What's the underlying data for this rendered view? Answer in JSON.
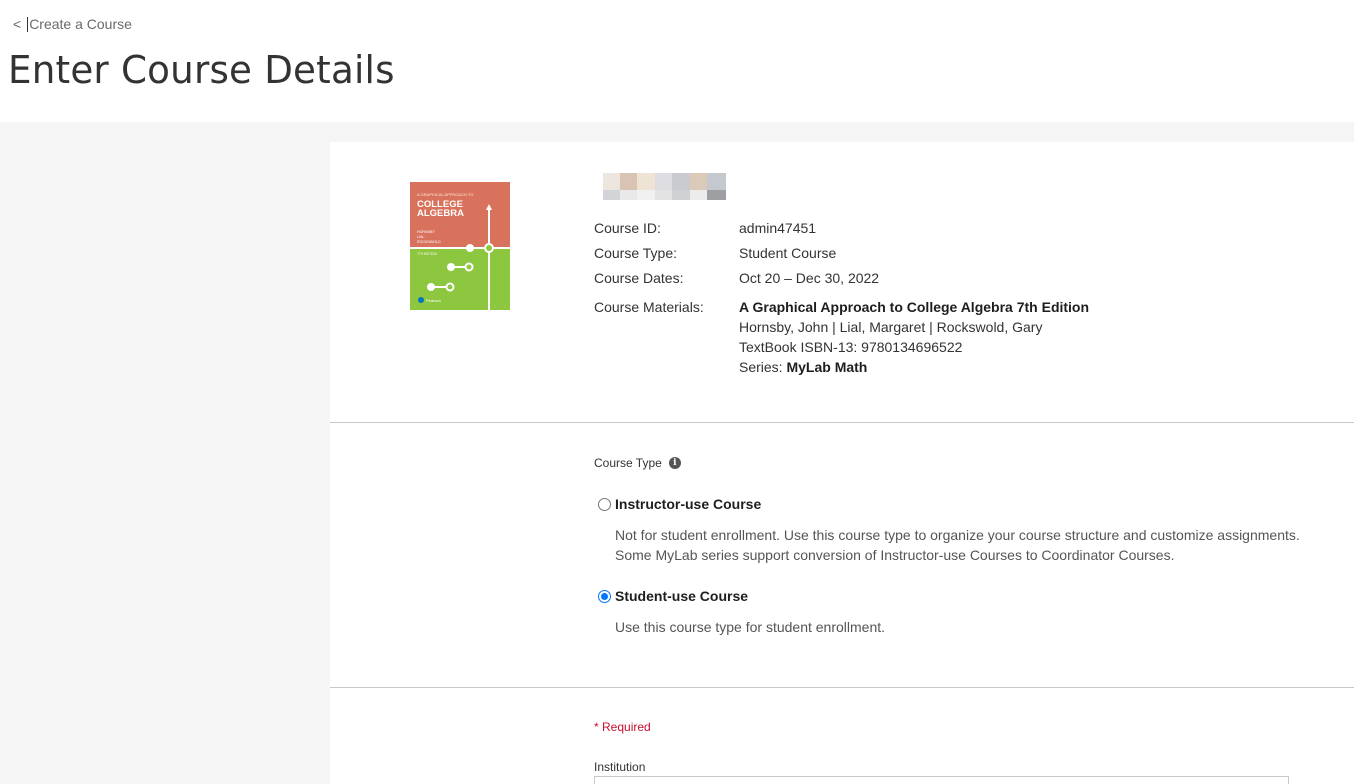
{
  "header": {
    "back_chevron": "<",
    "back_label": "Create a Course",
    "title": "Enter Course Details"
  },
  "course": {
    "cover": {
      "top_line": "A GRAPHICAL APPROACH TO",
      "title_line1": "COLLEGE",
      "title_line2": "ALGEBRA",
      "authors": [
        "HORNSBY",
        "LIAL",
        "ROCKSWOLD"
      ],
      "edition": "7TH EDITION",
      "publisher": "Pearson",
      "colors": {
        "top": "#d9725d",
        "bottom": "#8dc63f"
      }
    },
    "details": {
      "course_id_label": "Course ID:",
      "course_id": "admin47451",
      "course_type_label": "Course Type:",
      "course_type": "Student Course",
      "course_dates_label": "Course Dates:",
      "course_dates": "Oct 20 – Dec 30, 2022",
      "materials_label": "Course Materials:",
      "materials_title": "A Graphical Approach to College Algebra 7th Edition",
      "authors": "Hornsby, John | Lial, Margaret | Rockswold, Gary",
      "isbn": "TextBook ISBN-13: 9780134696522",
      "series_prefix": "Series: ",
      "series_name": "MyLab Math"
    }
  },
  "course_type_section": {
    "label": "Course Type",
    "info_icon": "i",
    "options": [
      {
        "title": "Instructor-use Course",
        "description": "Not for student enrollment. Use this course type to organize your course structure and customize assignments. Some MyLab series support conversion of Instructor-use Courses to Coordinator Courses.",
        "selected": false
      },
      {
        "title": "Student-use Course",
        "description": "Use this course type for student enrollment.",
        "selected": true
      }
    ]
  },
  "form": {
    "required_note": "* Required",
    "institution_label": "Institution",
    "institution_value": ""
  },
  "colors": {
    "accent": "#0075ff",
    "required": "#c8102e",
    "page_bg": "#f5f5f5"
  }
}
